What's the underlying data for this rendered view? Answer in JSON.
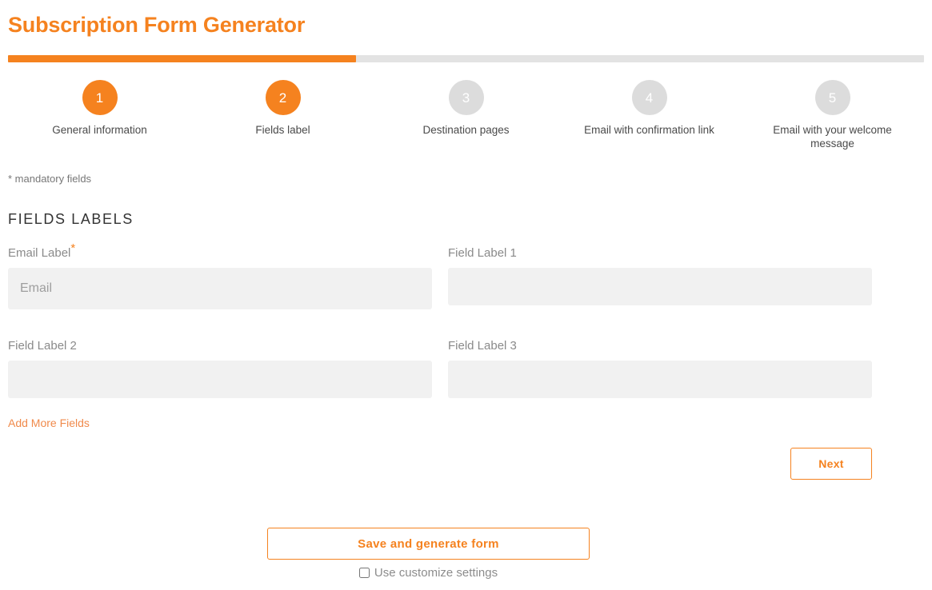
{
  "header": {
    "title": "Subscription Form Generator"
  },
  "progress": {
    "percent": 38
  },
  "stepper": {
    "steps": [
      {
        "number": "1",
        "label": "General information",
        "state": "active"
      },
      {
        "number": "2",
        "label": "Fields label",
        "state": "active"
      },
      {
        "number": "3",
        "label": "Destination pages",
        "state": "inactive"
      },
      {
        "number": "4",
        "label": "Email with confirmation link",
        "state": "inactive"
      },
      {
        "number": "5",
        "label": "Email with your welcome message",
        "state": "inactive"
      }
    ]
  },
  "notes": {
    "mandatory": "* mandatory fields"
  },
  "section": {
    "title": "FIELDS LABELS"
  },
  "fields": {
    "email": {
      "label": "Email Label",
      "required_marker": "*",
      "value": "",
      "placeholder": "Email"
    },
    "field1": {
      "label": "Field Label 1",
      "value": "",
      "placeholder": ""
    },
    "field2": {
      "label": "Field Label 2",
      "value": "",
      "placeholder": ""
    },
    "field3": {
      "label": "Field Label 3",
      "value": "",
      "placeholder": ""
    }
  },
  "actions": {
    "add_more_fields": "Add More Fields",
    "next": "Next",
    "save_and_generate": "Save and generate form",
    "use_customize_settings": "Use customize settings",
    "use_customize_settings_checked": false
  },
  "colors": {
    "accent": "#F5821F",
    "link": "#F08A4B",
    "inactive_step": "#DCDCDC",
    "field_background": "#F1F1F1",
    "progress_track": "#E3E3E3"
  }
}
